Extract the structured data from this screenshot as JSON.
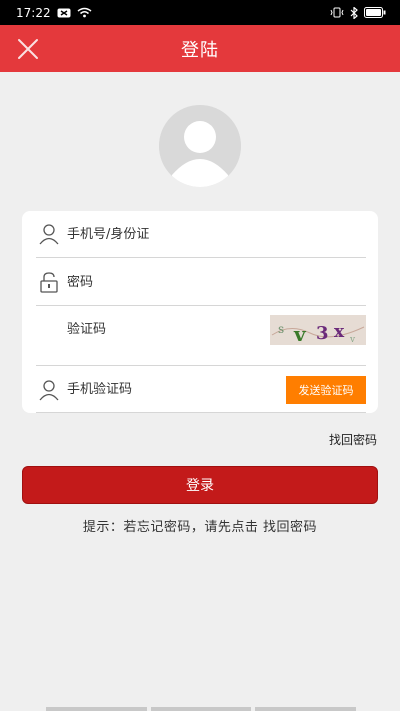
{
  "status_bar": {
    "time": "17:22",
    "battery": "battery-icon"
  },
  "header": {
    "title": "登陆",
    "close_icon": "close-icon"
  },
  "form": {
    "phone_id_placeholder": "手机号/身份证",
    "password_placeholder": "密码",
    "captcha_placeholder": "验证码",
    "captcha_text": "3 V 3 X",
    "sms_code_placeholder": "手机验证码",
    "send_code_label": "发送验证码"
  },
  "find_password_label": "找回密码",
  "login_label": "登录",
  "hint": "提示：若忘记密码，请先点击 找回密码",
  "colors": {
    "header": "#e4393c",
    "login_button": "#c31a1a",
    "send_code_button": "#ff7e00"
  }
}
